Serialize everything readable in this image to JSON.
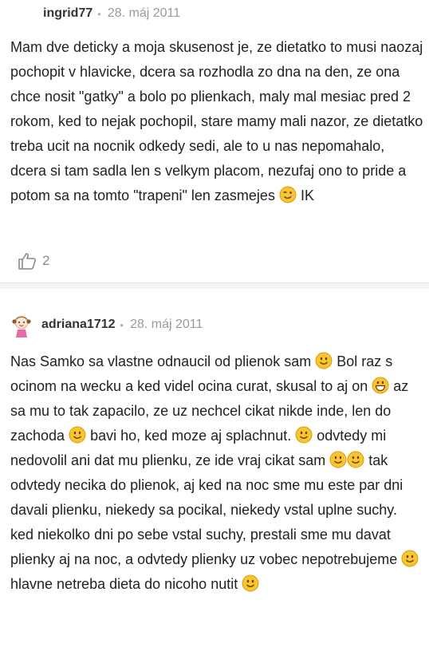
{
  "comments": [
    {
      "username": "ingrid77",
      "separator": "•",
      "date": "28. máj 2011",
      "text_before_emoji": "Mam dve deticky a moja skusenost je, ze dietatko to musi naozaj pochopit v hlavicke, dcera sa rozhodla zo dna na den, ze ona chce nosit \"gatky\" a bolo po plienkach, maly mal mesiac pred 2 rokom, ked to nejak pochopil, stare mamy mali nazor, ze dietatko treba ucit na nocnik odkedy sedi, ale to u nas nepomahalo, dcera si tam sadla len s velkym placom, nezufaj ono to pride a potom sa na tomto \"trapeni\" len zasmejes ",
      "text_after_emoji": " IK",
      "emoji": "wink-emoji",
      "likes_count": "2",
      "like_icon": "thumbs-up-icon"
    },
    {
      "username": "adriana1712",
      "separator": "•",
      "date": "28. máj 2011",
      "avatar_icon": "girl-avatar-icon",
      "segments": {
        "s1": "Nas Samko sa vlastne odnaucil od plienok sam ",
        "s2": " Bol raz s ocinom na wecku a ked videl ocina curat, skusal to aj on ",
        "s3": " az sa mu to tak zapacilo, ze uz nechcel cikat nikde inde, len do zachoda ",
        "s4": " bavi ho, ked moze aj splachnut. ",
        "s5": " odvtedy mi nedovolil ani dat mu plienku, ze ide vraj cikat sam ",
        "s6": " tak odvtedy necika do plienok, aj ked na noc sme mu este par dni davali plienku, niekedy sa pocikal, niekedy vstal uplne suchy. ked niekolko dni po sebe vstal suchy, prestali sme mu davat plienky aj na noc, a odvtedy plienky uz vobec nepotrebujeme ",
        "s7": " hlavne netreba dieta do nicoho nutit "
      },
      "emojis": [
        "smile-emoji",
        "grin-emoji",
        "smile-emoji",
        "smile-emoji",
        "smile-emoji",
        "smile-emoji",
        "smile-emoji",
        "smile-emoji"
      ]
    }
  ],
  "colors": {
    "emoji_face": "#f7c531",
    "emoji_edge": "#d99a0a",
    "muted": "#9a9a9a",
    "separator_bg": "#f4f4f4"
  }
}
